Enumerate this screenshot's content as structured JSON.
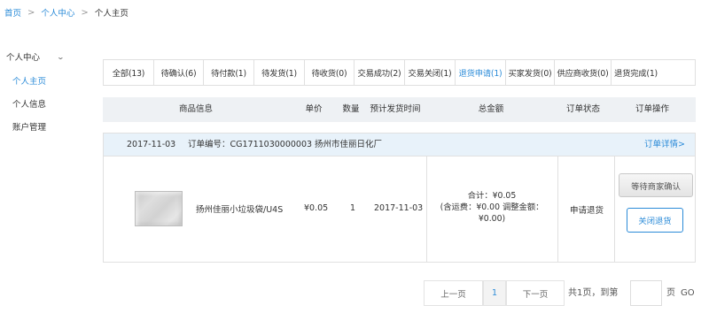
{
  "breadcrumb": {
    "home": "首页",
    "center": "个人中心",
    "current": "个人主页",
    "sep": ">"
  },
  "sidebar": {
    "header": "个人中心",
    "items": [
      {
        "label": "个人主页",
        "active": true
      },
      {
        "label": "个人信息",
        "active": false
      },
      {
        "label": "账户管理",
        "active": false
      }
    ]
  },
  "tabs": [
    {
      "label": "全部(13)"
    },
    {
      "label": "待确认(6)"
    },
    {
      "label": "待付款(1)"
    },
    {
      "label": "待发货(1)"
    },
    {
      "label": "待收货(0)"
    },
    {
      "label": "交易成功(2)"
    },
    {
      "label": "交易关闭(1)"
    },
    {
      "label": "退货申请(1)"
    },
    {
      "label": "买家发货(0)"
    },
    {
      "label": "供应商收货(0)"
    },
    {
      "label": "退货完成(1)"
    }
  ],
  "active_tab": "退货申请(1)",
  "table_header": {
    "product": "商品信息",
    "price": "单价",
    "qty": "数量",
    "ship_time": "预计发货时间",
    "total": "总金额",
    "status": "订单状态",
    "ops": "订单操作"
  },
  "order": {
    "date": "2017-11-03",
    "order_no": "订单编号：CG1711030000003",
    "shop": "扬州市佳丽日化厂",
    "detail_link": "订单详情>",
    "product_name": "扬州佳丽小垃圾袋/U4S",
    "price": "¥0.05",
    "qty": "1",
    "ship_date": "2017-11-03",
    "total_line1": "合计：¥0.05",
    "total_line2": "(含运费：¥0.00 调整金额：",
    "total_line3": "¥0.00)",
    "status": "申请退货",
    "wait_button": "等待商家确认",
    "close_button": "关闭退货"
  },
  "pagination": {
    "prev": "上一页",
    "page": "1",
    "next": "下一页",
    "total": "共1页，到第",
    "unit": "页",
    "go": "GO"
  }
}
